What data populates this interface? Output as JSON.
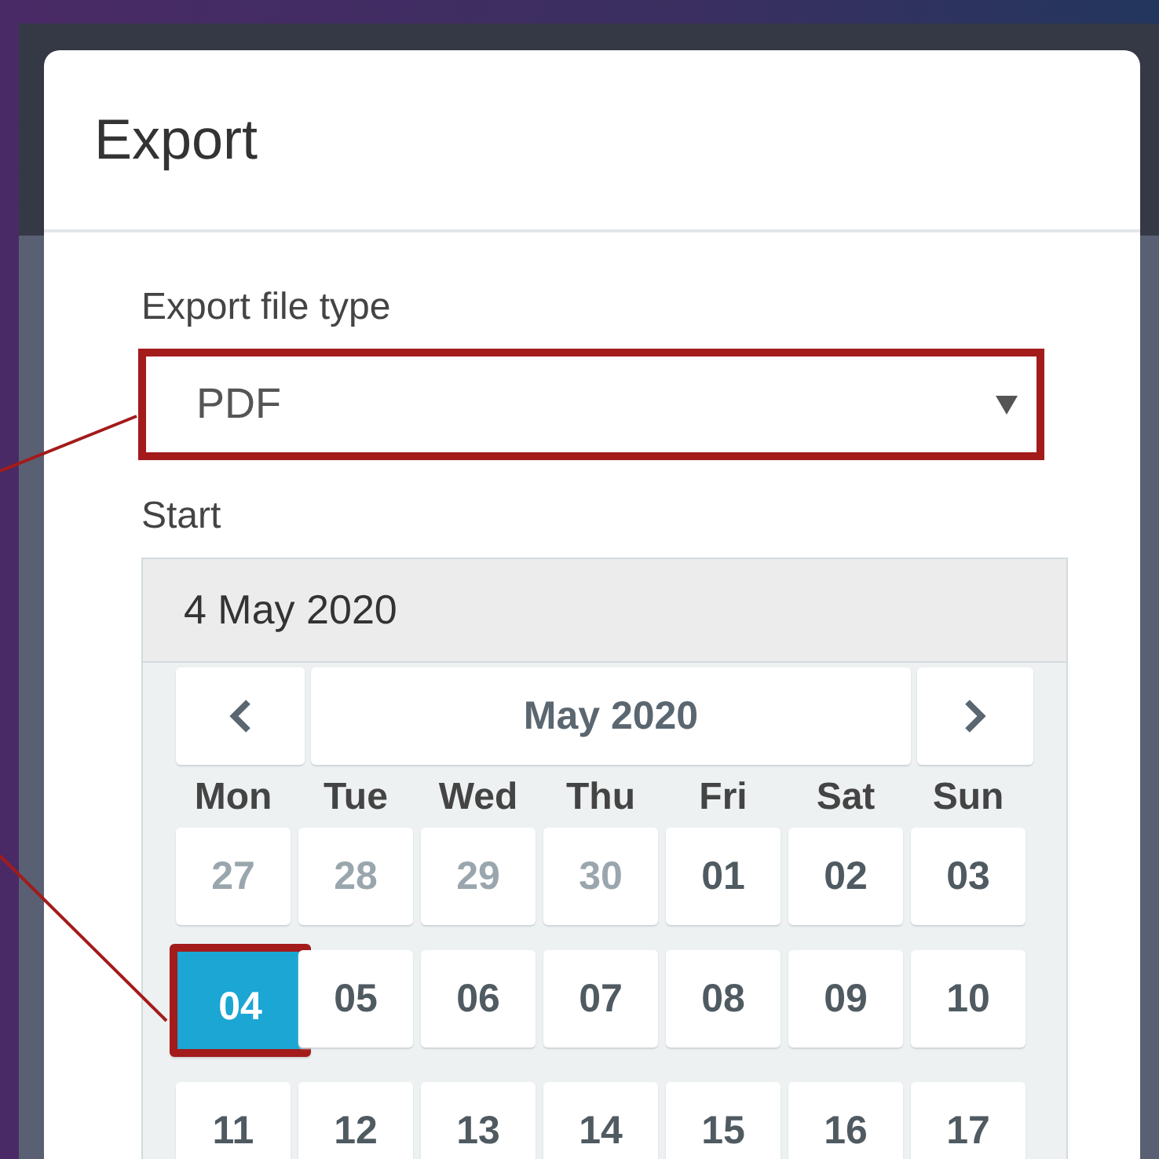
{
  "dialog": {
    "title": "Export"
  },
  "file_type": {
    "label": "Export file type",
    "value": "PDF",
    "highlighted": true
  },
  "start": {
    "label": "Start",
    "value": "4 May 2020"
  },
  "calendar": {
    "month": "May 2020",
    "weekdays": [
      "Mon",
      "Tue",
      "Wed",
      "Thu",
      "Fri",
      "Sat",
      "Sun"
    ],
    "weeks": [
      [
        {
          "day": "27",
          "muted": true,
          "selected": false,
          "highlighted": false
        },
        {
          "day": "28",
          "muted": true,
          "selected": false,
          "highlighted": false
        },
        {
          "day": "29",
          "muted": true,
          "selected": false,
          "highlighted": false
        },
        {
          "day": "30",
          "muted": true,
          "selected": false,
          "highlighted": false
        },
        {
          "day": "01",
          "muted": false,
          "selected": false,
          "highlighted": false
        },
        {
          "day": "02",
          "muted": false,
          "selected": false,
          "highlighted": false
        },
        {
          "day": "03",
          "muted": false,
          "selected": false,
          "highlighted": false
        }
      ],
      [
        {
          "day": "04",
          "muted": false,
          "selected": true,
          "highlighted": true
        },
        {
          "day": "05",
          "muted": false,
          "selected": false,
          "highlighted": false
        },
        {
          "day": "06",
          "muted": false,
          "selected": false,
          "highlighted": false
        },
        {
          "day": "07",
          "muted": false,
          "selected": false,
          "highlighted": false
        },
        {
          "day": "08",
          "muted": false,
          "selected": false,
          "highlighted": false
        },
        {
          "day": "09",
          "muted": false,
          "selected": false,
          "highlighted": false
        },
        {
          "day": "10",
          "muted": false,
          "selected": false,
          "highlighted": false
        }
      ],
      [
        {
          "day": "11",
          "muted": false,
          "selected": false,
          "highlighted": false
        },
        {
          "day": "12",
          "muted": false,
          "selected": false,
          "highlighted": false
        },
        {
          "day": "13",
          "muted": false,
          "selected": false,
          "highlighted": false
        },
        {
          "day": "14",
          "muted": false,
          "selected": false,
          "highlighted": false
        },
        {
          "day": "15",
          "muted": false,
          "selected": false,
          "highlighted": false
        },
        {
          "day": "16",
          "muted": false,
          "selected": false,
          "highlighted": false
        },
        {
          "day": "17",
          "muted": false,
          "selected": false,
          "highlighted": false
        }
      ]
    ]
  }
}
